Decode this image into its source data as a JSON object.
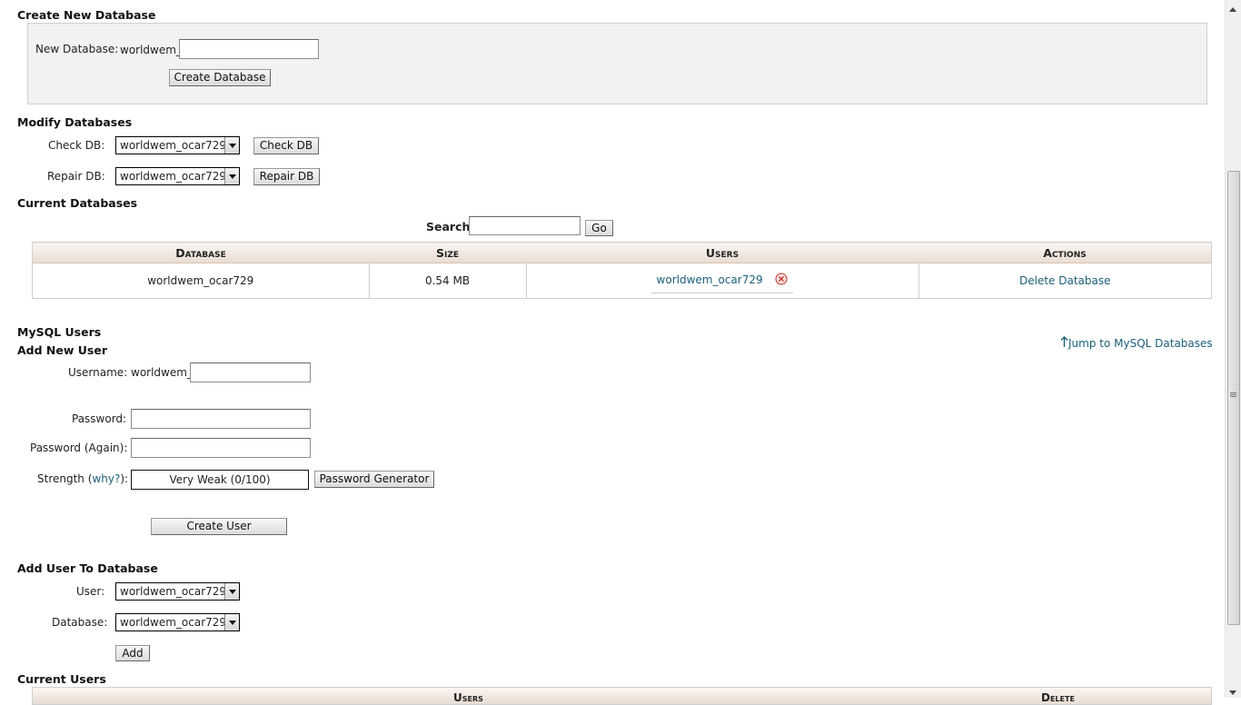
{
  "create_db": {
    "heading": "Create New Database",
    "label": "New Database:",
    "prefix": "worldwem_",
    "value": "",
    "button": "Create Database"
  },
  "modify_db": {
    "heading": "Modify Databases",
    "check_label": "Check DB:",
    "check_value": "worldwem_ocar729",
    "check_button": "Check DB",
    "repair_label": "Repair DB:",
    "repair_value": "worldwem_ocar729",
    "repair_button": "Repair DB"
  },
  "current_db": {
    "heading": "Current Databases",
    "search_label": "Search",
    "search_value": "",
    "go_button": "Go",
    "columns": [
      "Database",
      "Size",
      "Users",
      "Actions"
    ],
    "rows": [
      {
        "database": "worldwem_ocar729",
        "size": "0.54 MB",
        "user": "worldwem_ocar729",
        "action": "Delete Database"
      }
    ]
  },
  "mysql_users": {
    "heading": "MySQL Users",
    "subheading": "Add New User",
    "jump_link": "Jump to MySQL Databases",
    "username_label": "Username:",
    "username_prefix": "worldwem_",
    "username_value": "",
    "password_label": "Password:",
    "password_again_label": "Password (Again):",
    "strength_label": "Strength",
    "strength_open": "(",
    "why_link": "why?",
    "strength_close": "):",
    "strength_value": "Very Weak (0/100)",
    "generator_button": "Password Generator",
    "create_button": "Create User"
  },
  "add_user_db": {
    "heading": "Add User To Database",
    "user_label": "User:",
    "user_value": "worldwem_ocar729",
    "database_label": "Database:",
    "database_value": "worldwem_ocar729",
    "add_button": "Add"
  },
  "current_users": {
    "heading": "Current Users",
    "columns": [
      "Users",
      "Delete"
    ]
  },
  "icons": {
    "remove": "remove-user-icon",
    "arrow": "up-arrow-icon"
  }
}
